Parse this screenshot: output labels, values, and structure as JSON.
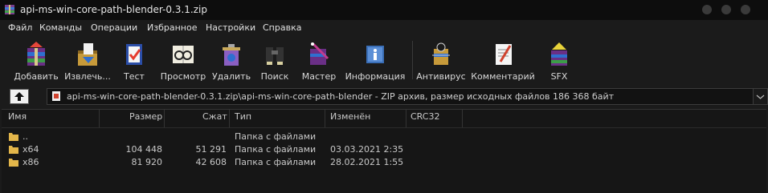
{
  "window": {
    "title": "api-ms-win-core-path-blender-0.3.1.zip"
  },
  "menu": [
    "Файл",
    "Команды",
    "Операции",
    "Избранное",
    "Настройки",
    "Справка"
  ],
  "toolbar": [
    {
      "label": "Добавить",
      "icon": "add-archive-icon"
    },
    {
      "label": "Извлечь...",
      "icon": "extract-icon"
    },
    {
      "label": "Тест",
      "icon": "test-icon"
    },
    {
      "label": "Просмотр",
      "icon": "view-icon"
    },
    {
      "label": "Удалить",
      "icon": "delete-icon"
    },
    {
      "label": "Поиск",
      "icon": "find-icon"
    },
    {
      "label": "Мастер",
      "icon": "wizard-icon"
    },
    {
      "label": "Информация",
      "icon": "info-icon"
    },
    {
      "label": "Антивирус",
      "icon": "virus-scan-icon"
    },
    {
      "label": "Комментарий",
      "icon": "comment-icon"
    },
    {
      "label": "SFX",
      "icon": "sfx-icon"
    }
  ],
  "address": {
    "text": "api-ms-win-core-path-blender-0.3.1.zip\\api-ms-win-core-path-blender - ZIP архив, размер исходных файлов 186 368 байт"
  },
  "columns": {
    "name": "Имя",
    "size": "Размер",
    "packed": "Сжат",
    "type": "Тип",
    "modified": "Изменён",
    "crc": "CRC32"
  },
  "rows": [
    {
      "name": "..",
      "size": "",
      "packed": "",
      "type": "Папка с файлами",
      "modified": "",
      "crc": ""
    },
    {
      "name": "x64",
      "size": "104 448",
      "packed": "51 291",
      "type": "Папка с файлами",
      "modified": "03.03.2021 2:35",
      "crc": ""
    },
    {
      "name": "x86",
      "size": "81 920",
      "packed": "42 608",
      "type": "Папка с файлами",
      "modified": "28.02.2021 1:55",
      "crc": ""
    }
  ],
  "colors": {
    "background": "#1b1b1b",
    "titlebar": "#0d0d0d",
    "folder": "#e3b64a"
  }
}
